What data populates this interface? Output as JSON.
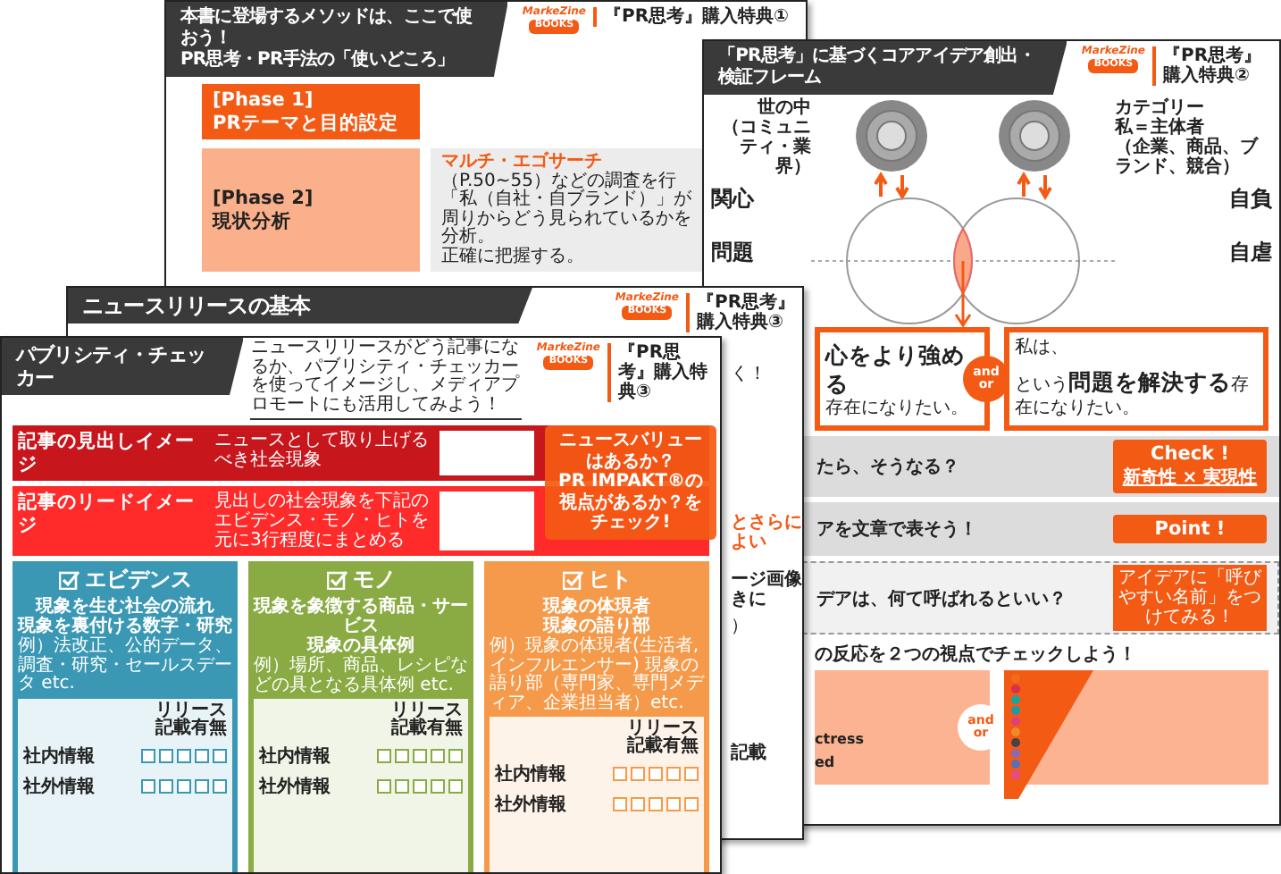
{
  "phase_sheet": {
    "title": [
      "本書に登場するメソッドは、ここで使おう！",
      "PR思考・PR手法の「使いどころ」"
    ],
    "logo": {
      "wordmark": "MarkeZine",
      "badge": "BOOKS"
    },
    "tag": "『PR思考』購入特典①",
    "phases": [
      {
        "kind": "primary",
        "label": "[Phase 1]",
        "name": "PRテーマと目的設定"
      },
      {
        "kind": "secondary",
        "label": "[Phase 2]",
        "name": "現状分析",
        "description": [
          "**マルチ・エゴサーチ**（P.50~55）などの調査を行",
          "「私（自社・自ブランド）」が",
          "周りからどう見られているかを分析。",
          "正確に把握する。"
        ]
      }
    ]
  },
  "frame_sheet": {
    "title": "「PR思考」に基づくコアアイデア創出・検証フレーム",
    "logo": {
      "wordmark": "MarkeZine",
      "badge": "BOOKS"
    },
    "tag": "『PR思考』購入特典②",
    "circle_labels": [
      [
        "世の中",
        "（コミュニティ・業界）"
      ],
      [
        "カテゴリー",
        "私＝主体者",
        "（企業、商品、ブランド、競合）"
      ]
    ],
    "quadrants": [
      "関心",
      "自負",
      "問題",
      "自虐"
    ],
    "statements": {
      "left": "**心をより強める**存在になりたい。",
      "right_intro": "私は、",
      "right": "という**問題を解決する**存在になりたい。",
      "connector": [
        "and",
        "or"
      ]
    },
    "steps": [
      {
        "kind": "check",
        "text": "たら、そうなる？",
        "badge_title": "Check !",
        "badge_text": "新奇性 × 実現性"
      },
      {
        "kind": "point",
        "text": "アを文章で表そう！",
        "badge_title": "Point !"
      },
      {
        "kind": "name",
        "text": "デアは、何て呼ばれるといい？",
        "badge_text": "アイデアに「呼びやすい名前」をつけてみる！"
      }
    ],
    "reaction": {
      "text": "の反応を２つの視点でチェックしよう！",
      "fragments": [
        "ctress",
        "ed"
      ],
      "connector": [
        "and",
        "or"
      ],
      "dots": [
        {
          "color": "#f26b1d"
        },
        {
          "color": "#d9304b"
        },
        {
          "color": "#1aa59b"
        },
        {
          "color": "#1f9aa5"
        },
        {
          "color": "#e0407a"
        },
        {
          "color": "#f0892a"
        },
        {
          "color": "#444444"
        },
        {
          "color": "#8a6bb0"
        },
        {
          "color": "#5a6fb5"
        },
        {
          "color": "#e64a8a"
        }
      ]
    }
  },
  "news_sheet": {
    "title": "ニュースリリースの基本",
    "logo": {
      "wordmark": "MarkeZine",
      "badge": "BOOKS"
    },
    "tag": "『PR思考』購入特典③",
    "fragments": [
      {
        "kind": "plain",
        "text": "く！"
      },
      {
        "kind": "accent",
        "text": "とさらによい"
      },
      {
        "kind": "bold",
        "text": "ージ画像"
      },
      {
        "kind": "bold",
        "text": "きに"
      },
      {
        "kind": "plain",
        "text": "）"
      },
      {
        "kind": "bold",
        "text": "記載"
      }
    ]
  },
  "checker_sheet": {
    "title": "パブリシティ・チェッカー",
    "subtitle": "ニュースリリースがどう記事になるか、パブリシティ・チェッカーを使ってイメージし、メディアプロモートにも活用してみよう！",
    "logo": {
      "wordmark": "MarkeZine",
      "badge": "BOOKS"
    },
    "tag": "『PR思考』購入特典③",
    "rows": [
      {
        "kind": "headline",
        "title": "記事の見出しイメージ",
        "note": "ニュースとして取り上げるべき社会現象"
      },
      {
        "kind": "lead",
        "title": "記事のリードイメージ",
        "note": "見出しの社会現象を下記のエビデンス・モノ・ヒトを元に3行程度にまとめる"
      }
    ],
    "callout": [
      "ニュースバリュー",
      "はあるか？",
      "PR IMPAKT®の",
      "視点があるか？を",
      "チェック!"
    ],
    "columns": [
      {
        "name": "エビデンス",
        "color": "#3a98b4",
        "description": [
          "現象を生む社会の流れ",
          "現象を裏付ける数字・研究"
        ],
        "example": "例）法改正、公的データ、調査・研究・セールスデータ etc.",
        "check_header": "リリース記載有無",
        "sections": [
          {
            "label": "社内情報",
            "checks": [
              false,
              false,
              false,
              false,
              false
            ]
          },
          {
            "label": "社外情報",
            "checks": [
              false,
              false,
              false,
              false,
              false
            ]
          }
        ]
      },
      {
        "name": "モノ",
        "color": "#8aab44",
        "description": [
          "現象を象徴する商品・サービス",
          "現象の具体例"
        ],
        "example": "例）場所、商品、レシピなどの具となる具体例 etc.",
        "check_header": "リリース記載有無",
        "sections": [
          {
            "label": "社内情報",
            "checks": [
              false,
              false,
              false,
              false,
              false
            ]
          },
          {
            "label": "社外情報",
            "checks": [
              false,
              false,
              false,
              false,
              false
            ]
          }
        ]
      },
      {
        "name": "ヒト",
        "color": "#f59a4a",
        "description": [
          "現象の体現者",
          "現象の語り部"
        ],
        "example": "例）現象の体現者(生活者,インフルエンサー) 現象の語り部（専門家、専門メディア、企業担当者）etc.",
        "check_header": "リリース記載有無",
        "sections": [
          {
            "label": "社内情報",
            "checks": [
              false,
              false,
              false,
              false,
              false
            ]
          },
          {
            "label": "社外情報",
            "checks": [
              false,
              false,
              false,
              false,
              false
            ]
          }
        ]
      }
    ]
  }
}
